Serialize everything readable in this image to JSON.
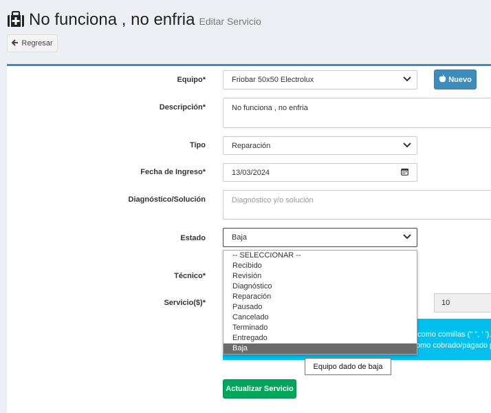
{
  "header": {
    "title": "No funciona , no enfria",
    "subtitle": "Editar Servicio",
    "icon": "medkit-icon"
  },
  "back_button": {
    "label": "Regresar",
    "icon": "arrow-left-icon"
  },
  "form": {
    "equipo": {
      "label": "Equipo*",
      "value": "Friobar 50x50 Electrolux"
    },
    "nuevo_button": {
      "label": "Nuevo",
      "icon": "apple-icon"
    },
    "descripcion": {
      "label": "Descripción*",
      "value": "No funciona , no enfria"
    },
    "tipo": {
      "label": "Tipo",
      "value": "Reparación"
    },
    "fecha": {
      "label": "Fecha de Ingreso*",
      "value": "13/03/2024"
    },
    "diagnostico": {
      "label": "Diagnóstico/Solución",
      "placeholder": "Diagnóstico y/o solución"
    },
    "estado": {
      "label": "Estado",
      "value": "Baja",
      "options": [
        "-- SELECCIONAR --",
        "Recibido",
        "Revisión",
        "Diagnóstico",
        "Reparación",
        "Pausado",
        "Cancelado",
        "Terminado",
        "Entregado",
        "Baja"
      ],
      "selected_index": 9
    },
    "tecnico": {
      "label": "Técnico*"
    },
    "servicio": {
      "label": "Servicio($)*",
      "value": "10"
    },
    "info_lines": [
      "como comillas (\" \", ' ').",
      "omo cobrado/pagado p"
    ],
    "update_button": {
      "label": "Actualizar Servicio"
    }
  },
  "tooltip": "Equipo dado de baja",
  "colors": {
    "primary": "#3c8dbc",
    "success": "#00a65a",
    "info": "#00c0ef",
    "background": "#ecf0f5"
  }
}
